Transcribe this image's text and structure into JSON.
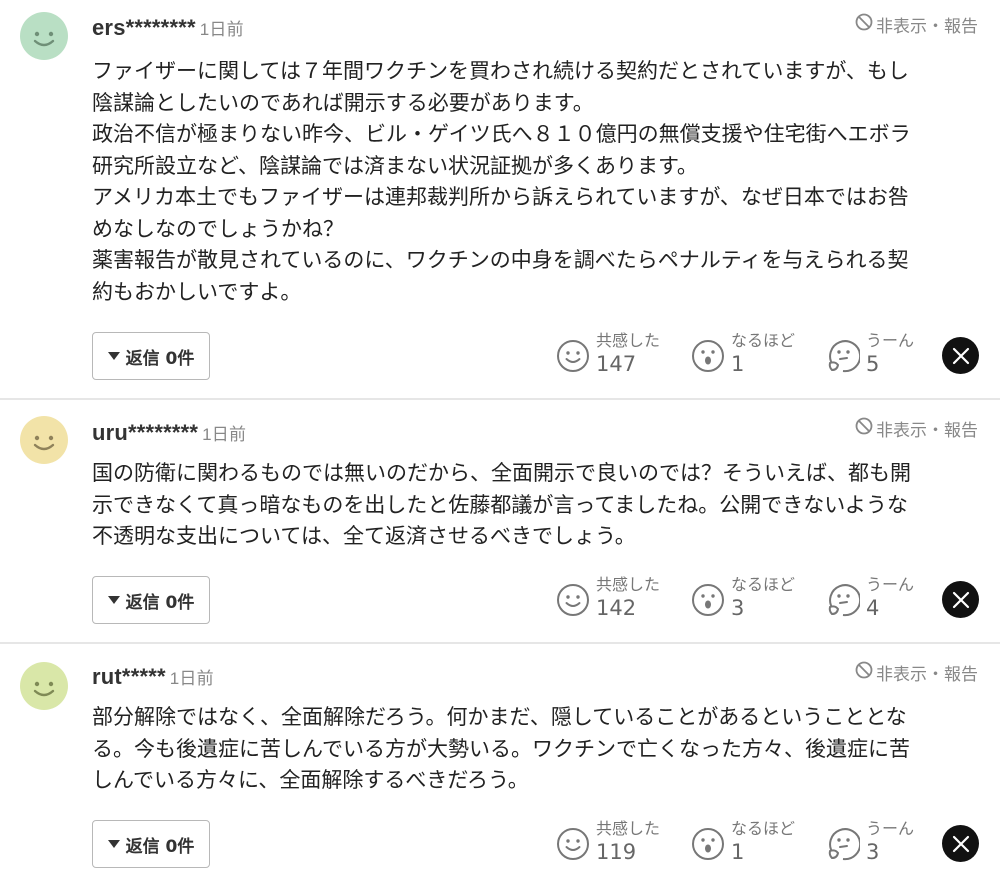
{
  "common": {
    "report_label": "非表示・報告",
    "reaction_labels": {
      "agree": "共感した",
      "insight": "なるほど",
      "hmm": "うーん"
    },
    "x_icon": "x-logo-icon",
    "colors": {
      "avatar_green": "#b9dfc4",
      "avatar_yellow": "#f2e3a8",
      "avatar_lime": "#d9e7a8",
      "face": "#7a7a5a"
    }
  },
  "comments": [
    {
      "user": "ers********",
      "time": "1日前",
      "body": "ファイザーに関しては７年間ワクチンを買わされ続ける契約だとされていますが、もし\n陰謀論としたいのであれば開示する必要があります。\n政治不信が極まりない昨今、ビル・ゲイツ氏へ８１０億円の無償支援や住宅街へエボラ\n研究所設立など、陰謀論では済まない状況証拠が多くあります。\nアメリカ本土でもファイザーは連邦裁判所から訴えられていますが、なぜ日本ではお咎\nめなしなのでしょうかね？\n薬害報告が散見されているのに、ワクチンの中身を調べたらペナルティを与えられる契\n約もおかしいですよ。",
      "reply_label": "返信 0件",
      "agree": "147",
      "insight": "1",
      "hmm": "5",
      "avatar": "green-smiley-avatar"
    },
    {
      "user": "uru********",
      "time": "1日前",
      "body": "国の防衛に関わるものでは無いのだから、全面開示で良いのでは？そういえば、都も開\n示できなくて真っ暗なものを出したと佐藤都議が言ってましたね。公開できないような\n不透明な支出については、全て返済させるべきでしょう。",
      "reply_label": "返信 0件",
      "agree": "142",
      "insight": "3",
      "hmm": "4",
      "avatar": "yellow-smiley-avatar"
    },
    {
      "user": "rut*****",
      "time": "1日前",
      "body": "部分解除ではなく、全面解除だろう。何かまだ、隠していることがあるということとな\nる。今も後遺症に苦しんでいる方が大勢いる。ワクチンで亡くなった方々、後遺症に苦\nしんでいる方々に、全面解除するべきだろう。",
      "reply_label": "返信 0件",
      "agree": "119",
      "insight": "1",
      "hmm": "3",
      "avatar": "lime-smiley-avatar"
    }
  ]
}
